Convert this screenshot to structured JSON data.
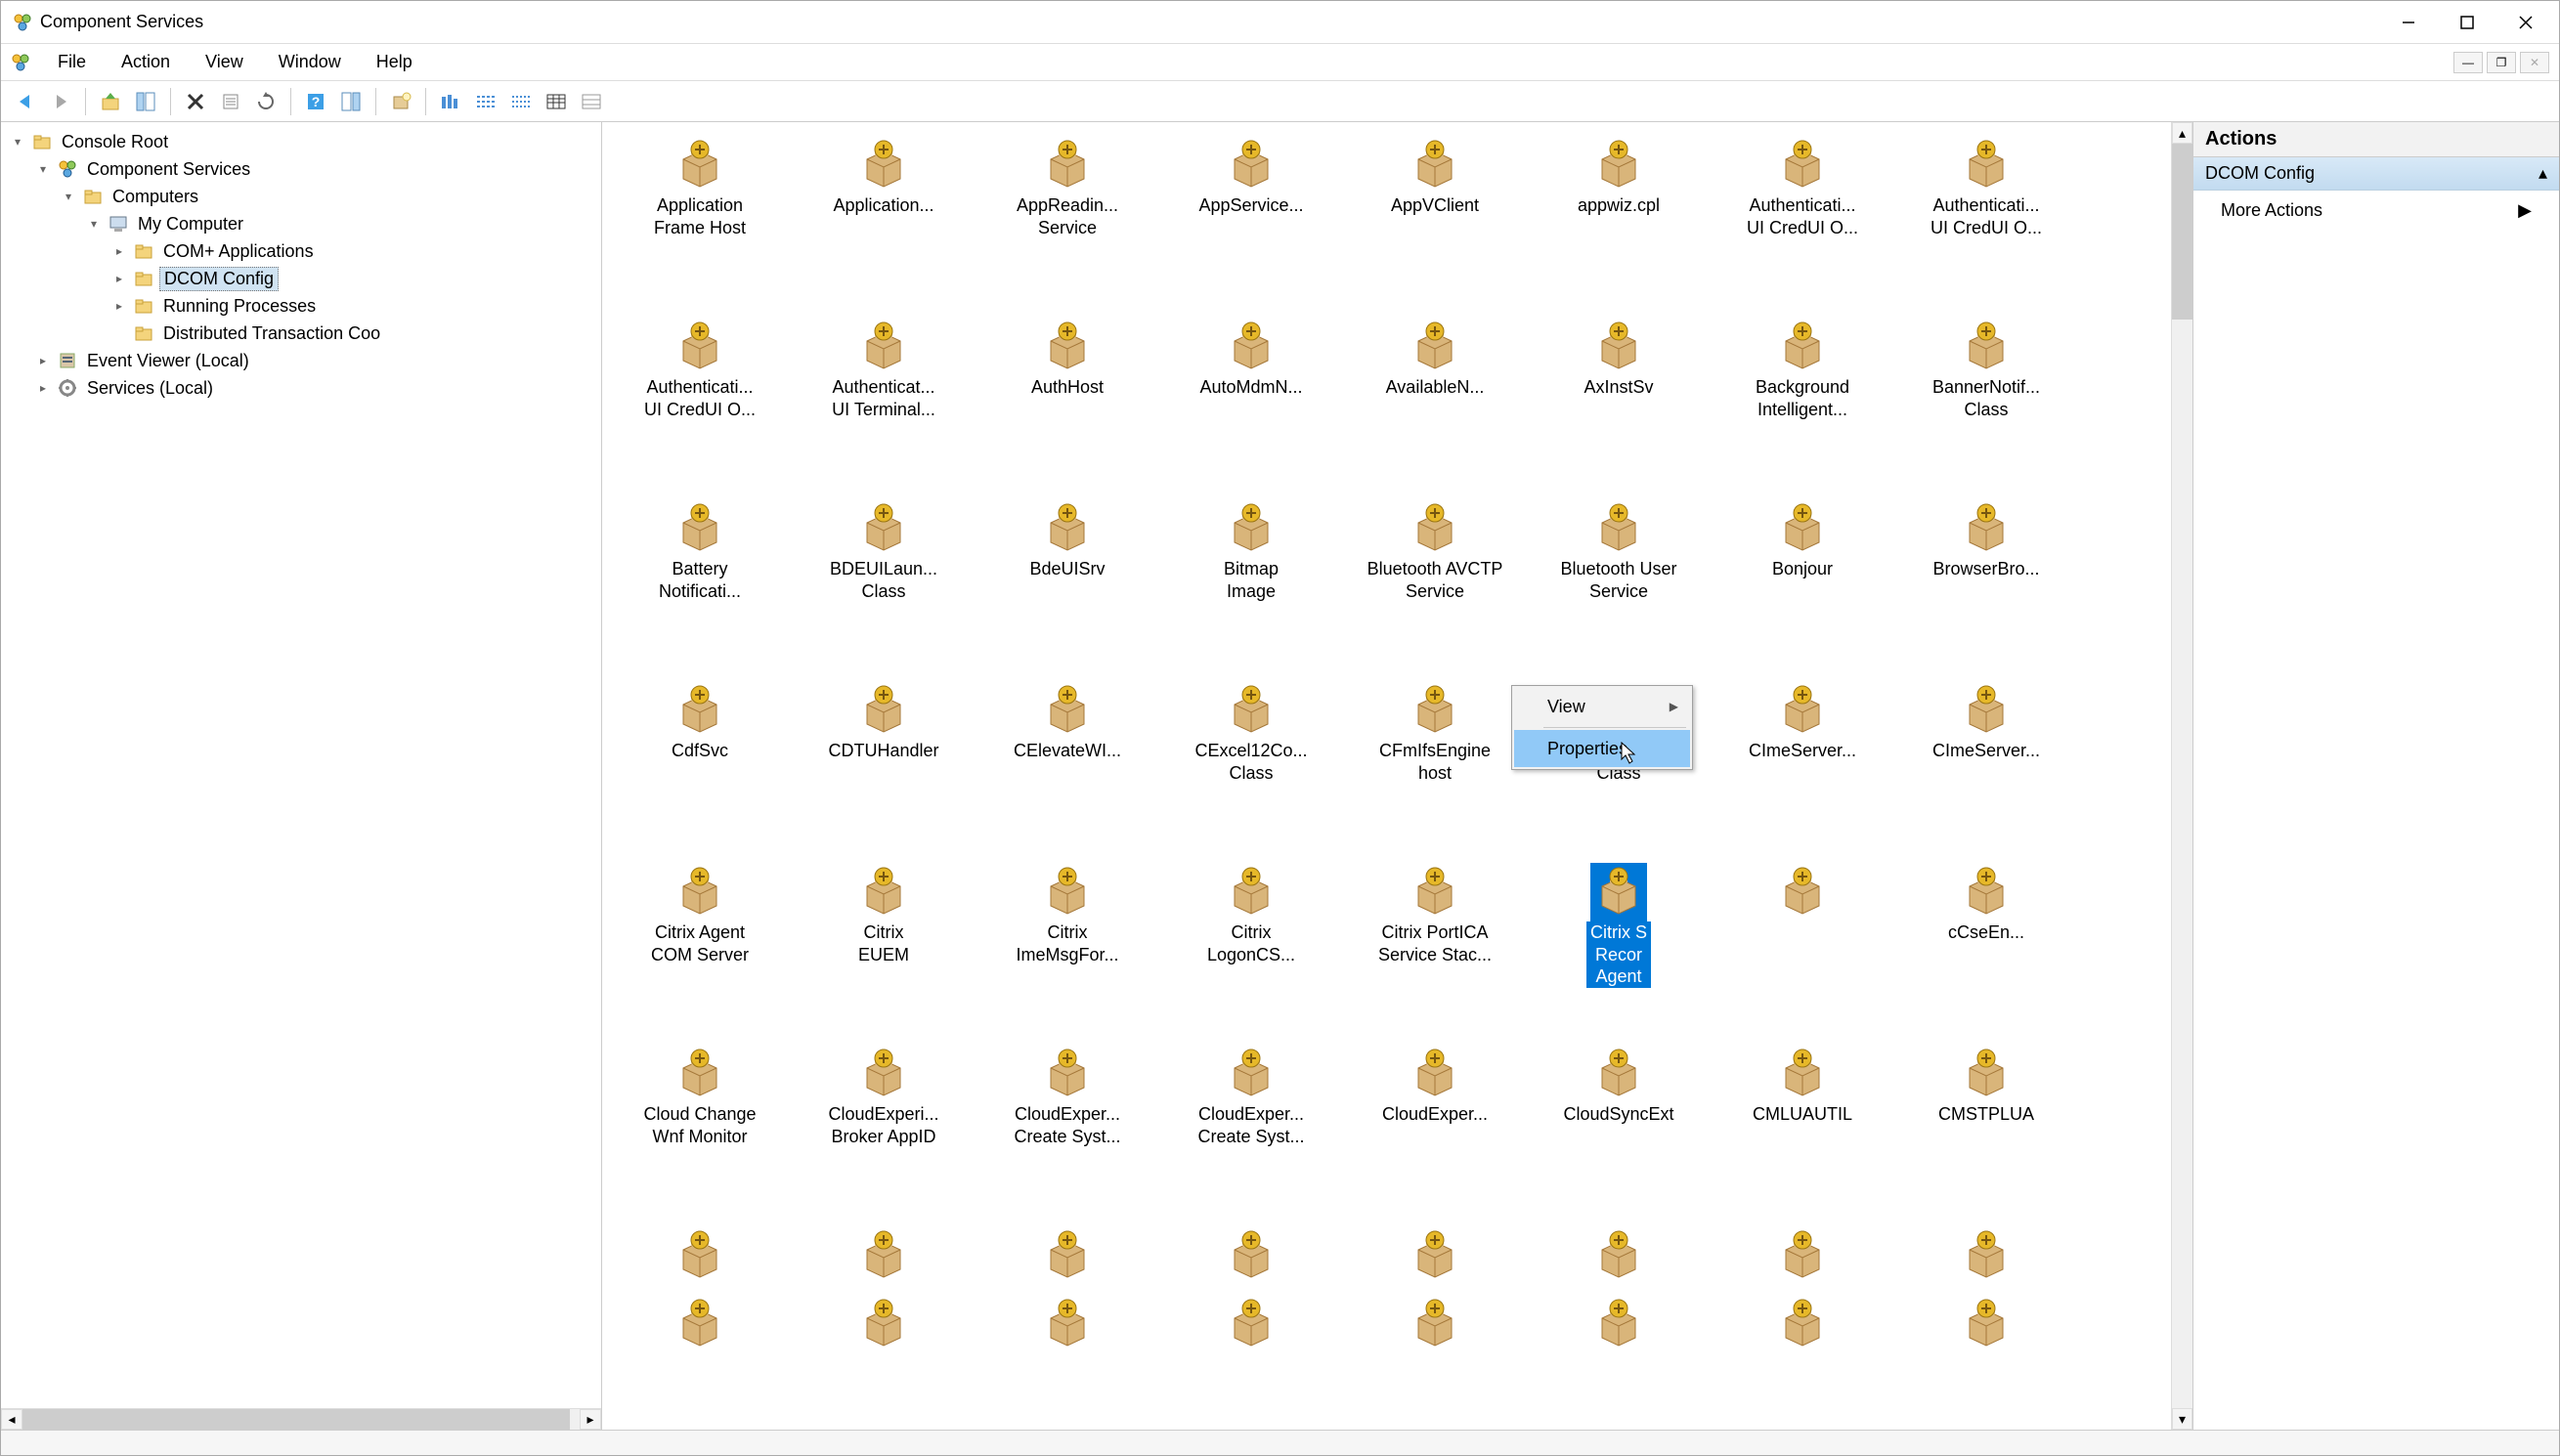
{
  "window": {
    "title": "Component Services"
  },
  "menubar": {
    "items": [
      "File",
      "Action",
      "View",
      "Window",
      "Help"
    ]
  },
  "tree": {
    "root": "Console Root",
    "nodes": [
      {
        "indent": 0,
        "exp": "▾",
        "icon": "folder",
        "label": "Console Root"
      },
      {
        "indent": 1,
        "exp": "▾",
        "icon": "component",
        "label": "Component Services"
      },
      {
        "indent": 2,
        "exp": "▾",
        "icon": "folder",
        "label": "Computers"
      },
      {
        "indent": 3,
        "exp": "▾",
        "icon": "computer",
        "label": "My Computer"
      },
      {
        "indent": 4,
        "exp": "▸",
        "icon": "folder",
        "label": "COM+ Applications"
      },
      {
        "indent": 4,
        "exp": "▸",
        "icon": "folder",
        "label": "DCOM Config",
        "selected": true
      },
      {
        "indent": 4,
        "exp": "▸",
        "icon": "folder",
        "label": "Running Processes"
      },
      {
        "indent": 4,
        "exp": "",
        "icon": "folder",
        "label": "Distributed Transaction Coo"
      },
      {
        "indent": 1,
        "exp": "▸",
        "icon": "event",
        "label": "Event Viewer (Local)"
      },
      {
        "indent": 1,
        "exp": "▸",
        "icon": "services",
        "label": "Services (Local)"
      }
    ]
  },
  "actions": {
    "header": "Actions",
    "section": "DCOM Config",
    "items": [
      "More Actions"
    ]
  },
  "dcom_items": [
    "Application Frame Host",
    "Application...",
    "AppReadin... Service",
    "AppService...",
    "AppVClient",
    "appwiz.cpl",
    "Authenticati... UI CredUI O...",
    "Authenticati... UI CredUI O...",
    "Authenticati... UI CredUI O...",
    "Authenticat... UI Terminal...",
    "AuthHost",
    "AutoMdmN...",
    "AvailableN...",
    "AxInstSv",
    "Background Intelligent...",
    "BannerNotif... Class",
    "Battery Notificati...",
    "BDEUILaun... Class",
    "BdeUISrv",
    "Bitmap Image",
    "Bluetooth AVCTP Service",
    "Bluetooth User Service",
    "Bonjour",
    "BrowserBro...",
    "CdfSvc",
    "CDTUHandler",
    "CElevateWI...",
    "CExcel12Co... Class",
    "CFmIfsEngine host",
    "CImeSearch... Class",
    "CImeServer...",
    "CImeServer...",
    "Citrix Agent COM Server",
    "Citrix EUEM",
    "Citrix ImeMsgFor...",
    "Citrix LogonCS...",
    "Citrix PortICA Service Stac...",
    "Citrix Session Recording Agent",
    "",
    "cCseEn...",
    "Cloud Change Wnf Monitor",
    "CloudExperi... Broker AppID",
    "CloudExper... Create Syst...",
    "CloudExper... Create Syst...",
    "CloudExper...",
    "CloudSyncExt",
    "CMLUAUTIL",
    "CMSTPLUA",
    "",
    "",
    "",
    "",
    "",
    "",
    "",
    "",
    "",
    "",
    "",
    "",
    "",
    "",
    "",
    ""
  ],
  "selected_index": 37,
  "context_menu": {
    "items": [
      "View",
      "Properties"
    ],
    "highlighted": 1
  },
  "colors": {
    "selection": "#0078d7",
    "action_hdr": "#c9ddef"
  }
}
